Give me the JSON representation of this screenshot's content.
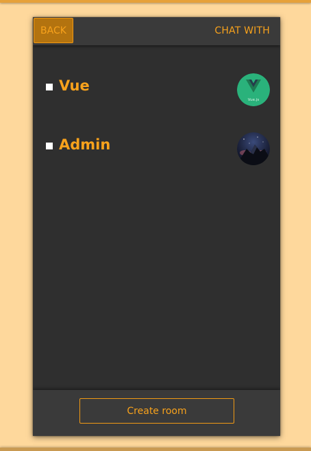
{
  "header": {
    "back_label": "BACK",
    "title": "CHAT WITH"
  },
  "rooms": [
    {
      "name": "Vue",
      "avatar_icon": "vuejs-logo-icon",
      "avatar_text": "Vue.js",
      "avatar_color": "#2ab27b"
    },
    {
      "name": "Admin",
      "avatar_icon": "mountain-night-photo-icon",
      "avatar_color": "#1c2233"
    }
  ],
  "footer": {
    "create_room_label": "Create room"
  },
  "colors": {
    "accent": "#f8a21c",
    "page_background": "#fed89c",
    "panel_background": "#2f2f2f",
    "bar_background": "#3a3a3a"
  }
}
